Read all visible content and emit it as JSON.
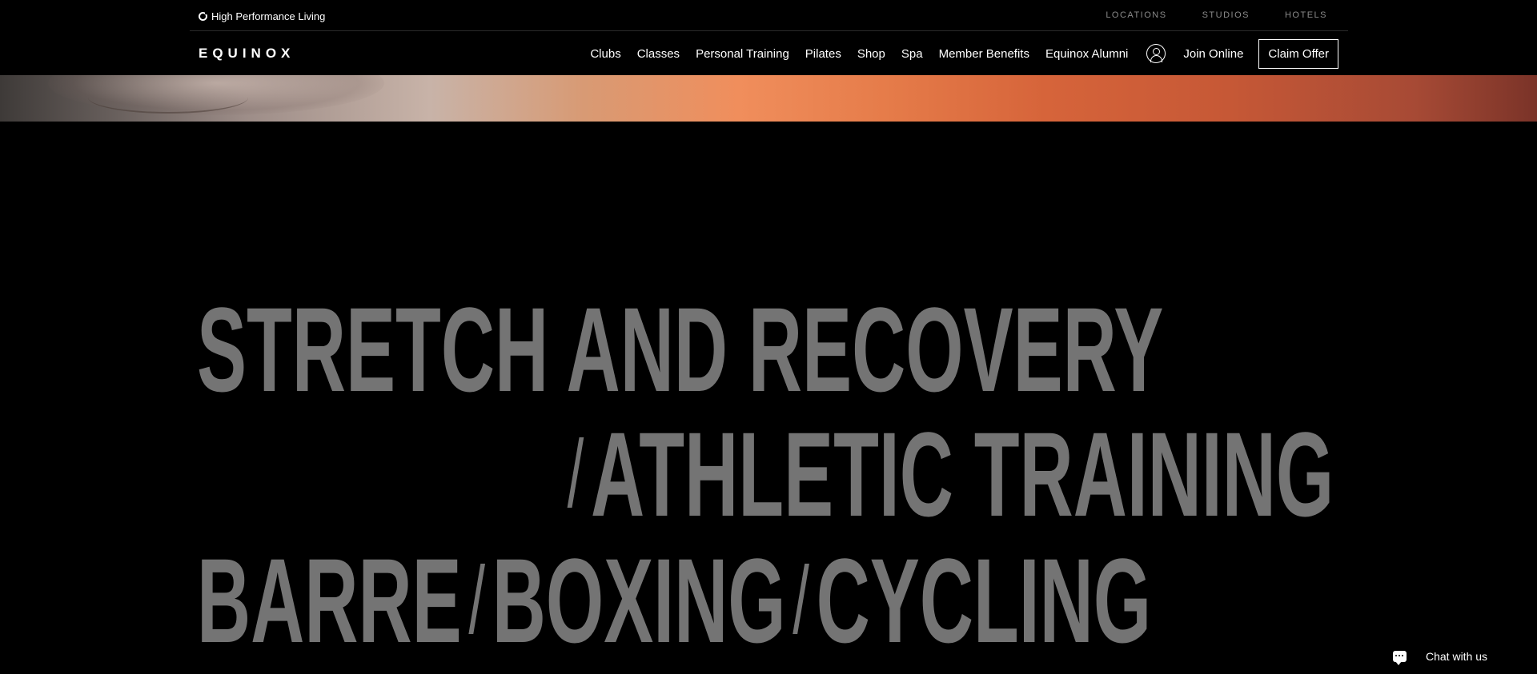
{
  "utility": {
    "tagline": "High Performance Living",
    "links": [
      "LOCATIONS",
      "STUDIOS",
      "HOTELS"
    ]
  },
  "nav": {
    "logo": "EQUINOX",
    "items": [
      "Clubs",
      "Classes",
      "Personal Training",
      "Pilates",
      "Shop",
      "Spa",
      "Member Benefits",
      "Equinox Alumni"
    ],
    "account_icon": "account-icon",
    "join_online": "Join Online",
    "claim_offer": "Claim Offer"
  },
  "categories": {
    "line1": [
      "STRETCH AND RECOVERY"
    ],
    "line2": [
      "ATHLETIC TRAINING"
    ],
    "line3": [
      "BARRE",
      "BOXING",
      "CYCLING"
    ],
    "separator": "/"
  },
  "chat": {
    "label": "Chat with us",
    "icon": "chat-bubble-icon"
  },
  "colors": {
    "background": "#000000",
    "category_text": "#747474",
    "utility_link": "#8a8a8a"
  }
}
